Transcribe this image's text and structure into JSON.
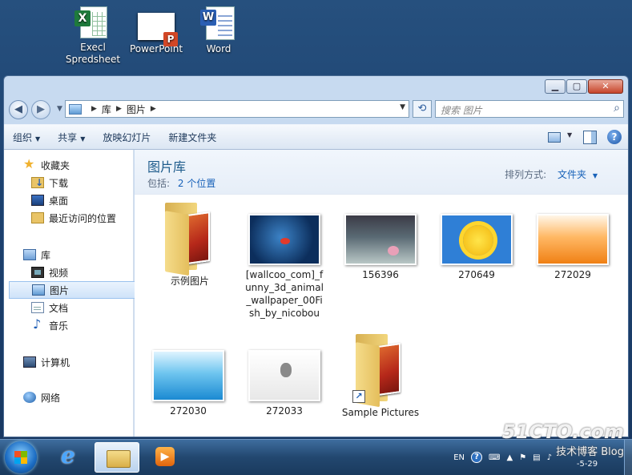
{
  "desktop": {
    "icons": [
      {
        "label_line1": "Execl",
        "label_line2": "Spredsheet",
        "icon": "excel-icon"
      },
      {
        "label_line1": "PowerPoint",
        "icon": "powerpoint-icon"
      },
      {
        "label_line1": "Word",
        "icon": "word-icon"
      }
    ]
  },
  "window": {
    "caption_buttons": {
      "minimize": "▁",
      "maximize": "▢",
      "close": "✕"
    },
    "address": {
      "crumbs": [
        "库",
        "图片"
      ],
      "search_placeholder": "搜索 图片"
    },
    "toolbar": {
      "organize": "组织",
      "share": "共享",
      "slideshow": "放映幻灯片",
      "new_folder": "新建文件夹"
    },
    "nav": {
      "favorites": "收藏夹",
      "downloads": "下载",
      "desktop": "桌面",
      "recent": "最近访问的位置",
      "libraries": "库",
      "videos": "视频",
      "pictures": "图片",
      "documents": "文档",
      "music": "音乐",
      "computer": "计算机",
      "network": "网络"
    },
    "library": {
      "title": "图片库",
      "includes_label": "包括:",
      "locations_link": "2 个位置",
      "arrange_label": "排列方式:",
      "arrange_value": "文件夹"
    },
    "items": [
      {
        "name": "示例图片",
        "kind": "folder"
      },
      {
        "name_lines": [
          "[wallcoo_com]_f",
          "unny_3d_animal",
          "_wallpaper_00Fi",
          "sh_by_nicobou"
        ],
        "kind": "image"
      },
      {
        "name": "156396",
        "kind": "image"
      },
      {
        "name": "270649",
        "kind": "image"
      },
      {
        "name": "272029",
        "kind": "image"
      },
      {
        "name": "272030",
        "kind": "image"
      },
      {
        "name": "272033",
        "kind": "image"
      },
      {
        "name": "Sample Pictures",
        "kind": "folder-shortcut"
      }
    ]
  },
  "taskbar": {
    "lang": "EN",
    "watermark_line1": "51CTO.com",
    "watermark_line2": "技术博客 Blog",
    "clock_date": "-5-29"
  },
  "colors": {
    "accent": "#1862b9",
    "title": "#1e5c8c",
    "taskbar": "#22476f"
  }
}
